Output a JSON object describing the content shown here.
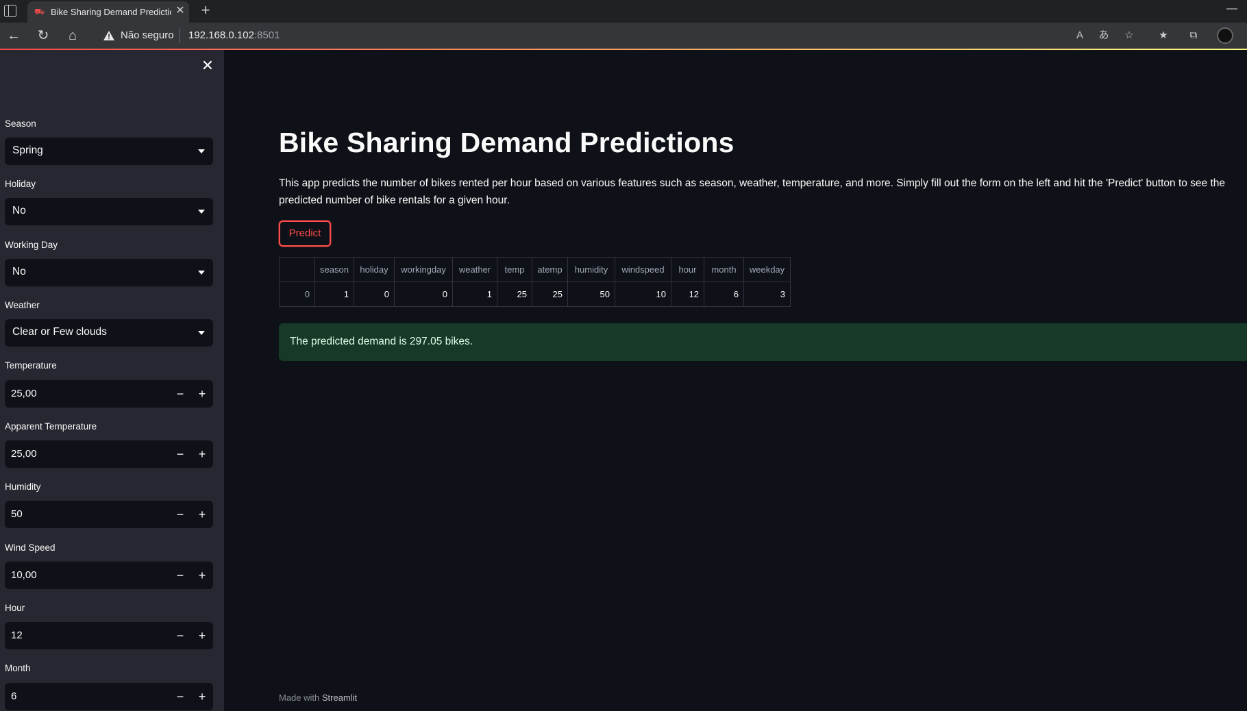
{
  "browser": {
    "tab_title": "Bike Sharing Demand Predictions",
    "security_label": "Não seguro",
    "url_host": "192.168.0.102",
    "url_port": ":8501"
  },
  "sidebar": {
    "fields": {
      "season": {
        "label": "Season",
        "value": "Spring"
      },
      "holiday": {
        "label": "Holiday",
        "value": "No"
      },
      "workingday": {
        "label": "Working Day",
        "value": "No"
      },
      "weather": {
        "label": "Weather",
        "value": "Clear or Few clouds"
      },
      "temperature": {
        "label": "Temperature",
        "value": "25,00"
      },
      "apparent_temperature": {
        "label": "Apparent Temperature",
        "value": "25,00"
      },
      "humidity": {
        "label": "Humidity",
        "value": "50"
      },
      "wind_speed": {
        "label": "Wind Speed",
        "value": "10,00"
      },
      "hour": {
        "label": "Hour",
        "value": "12"
      },
      "month": {
        "label": "Month",
        "value": "6"
      }
    }
  },
  "main": {
    "title": "Bike Sharing Demand Predictions",
    "description": "This app predicts the number of bikes rented per hour based on various features such as season, weather, temperature, and more. Simply fill out the form on the left and hit the 'Predict' button to see the predicted number of bike rentals for a given hour.",
    "predict_label": "Predict",
    "table": {
      "columns": [
        "",
        "season",
        "holiday",
        "workingday",
        "weather",
        "temp",
        "atemp",
        "humidity",
        "windspeed",
        "hour",
        "month",
        "weekday"
      ],
      "rows": [
        [
          "0",
          "1",
          "0",
          "0",
          "1",
          "25",
          "25",
          "50",
          "10",
          "12",
          "6",
          "3"
        ]
      ]
    },
    "result": "The predicted demand is 297.05 bikes."
  },
  "footer": {
    "prefix": "Made with",
    "brand": "Streamlit"
  }
}
